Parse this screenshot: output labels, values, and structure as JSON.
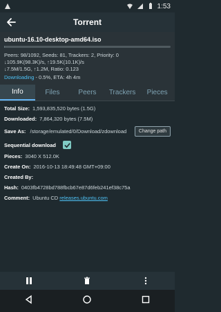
{
  "status_bar": {
    "time": "1:53"
  },
  "app_bar": {
    "title": "Torrent"
  },
  "torrent": {
    "name": "ubuntu-16.10-desktop-amd64.iso",
    "progress_fraction": 0.005,
    "meta_lines": [
      "Peers: 98/1092, Seeds: 81, Trackers: 2, Priority: 0",
      "↓105.9K(98.3K)/s, ↑19.5K(10.1K)/s",
      "↓7.5M/1.5G, ↑1.2M, Ratio: 0.123"
    ],
    "state": "Downloading",
    "state_rest": " - 0.5%, ETA: 4h 4m"
  },
  "tabs": [
    {
      "label": "Info",
      "active": true
    },
    {
      "label": "Files"
    },
    {
      "label": "Peers"
    },
    {
      "label": "Trackers"
    },
    {
      "label": "Pieces"
    }
  ],
  "info": {
    "total_size_label": "Total Size:",
    "total_size_value": "1,593,835,520 bytes (1.5G)",
    "downloaded_label": "Downloaded:",
    "downloaded_value": "7,864,320 bytes (7.5M)",
    "save_as_label": "Save As:",
    "save_as_value": "/storage/emulated/0/Download/zdownload",
    "change_path_label": "Change path",
    "sequential_label": "Sequential download",
    "sequential_checked": true,
    "pieces_label": "Pieces:",
    "pieces_value": "3040 X 512.0K",
    "create_on_label": "Create On:",
    "create_on_value": "2016-10-13 18:49:48 GMT+09:00",
    "created_by_label": "Created By:",
    "created_by_value": "",
    "hash_label": "Hash:",
    "hash_value": "0403fb4728bd788fbcb67e87d6feb241ef38c75a",
    "comment_label": "Comment:",
    "comment_text": "Ubuntu CD ",
    "comment_link": "releases.ubuntu.com"
  },
  "icons": {
    "back": "arrow-left-icon",
    "pause": "pause-icon",
    "delete": "trash-icon",
    "more": "more-vert-icon"
  }
}
